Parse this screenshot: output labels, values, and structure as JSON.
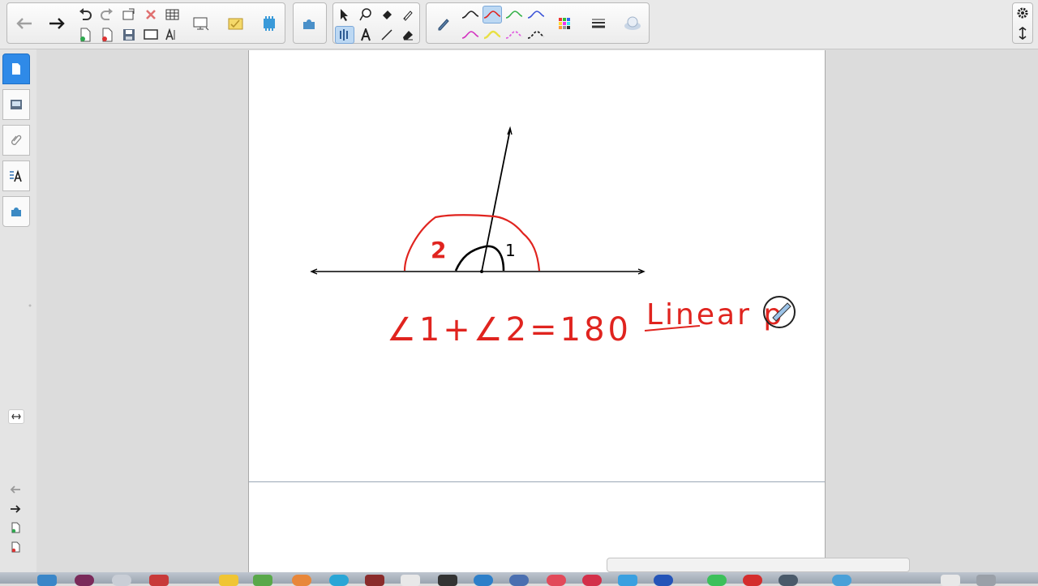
{
  "canvas": {
    "angle_label_1": "1",
    "angle_label_2": "2",
    "equation": "∠1+∠2=180",
    "annotation": "Linear p"
  },
  "colors": {
    "ink_black": "#000000",
    "ink_red": "#e0241f",
    "accent_blue": "#2f8ae8"
  },
  "toolbar_icons": [
    "back-arrow-icon",
    "forward-arrow-icon",
    "undo-icon",
    "redo-icon",
    "new-page-icon",
    "delete-icon",
    "table-icon",
    "screen-icon",
    "measure-icon",
    "addon-icon",
    "select-icon",
    "shape-icon",
    "fill-icon",
    "eraser-icon",
    "pen-icon",
    "line-style-icon",
    "color-palette-icon",
    "line-width-icon",
    "properties-icon",
    "settings-icon"
  ]
}
